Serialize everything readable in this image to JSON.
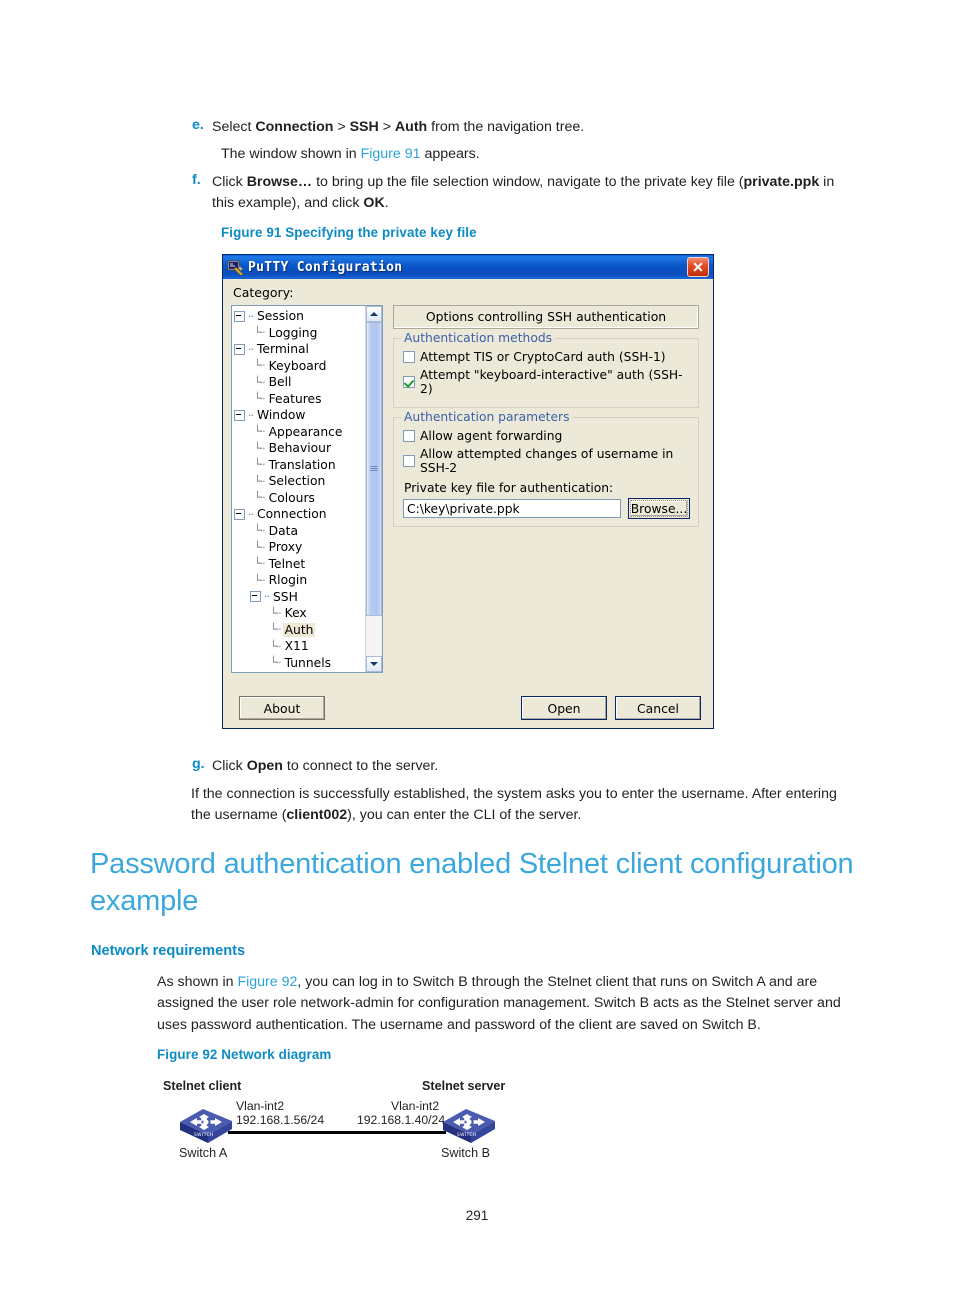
{
  "steps": [
    {
      "marker": "e.",
      "segments": [
        {
          "t": "Select ",
          "s": "normal"
        },
        {
          "t": "Connection",
          "s": "bold"
        },
        {
          "t": " > ",
          "s": "normal"
        },
        {
          "t": "SSH",
          "s": "bold"
        },
        {
          "t": " > ",
          "s": "normal"
        },
        {
          "t": "Auth",
          "s": "bold"
        },
        {
          "t": " from the navigation tree.",
          "s": "normal"
        }
      ]
    },
    {
      "marker": "f.",
      "segments": [
        {
          "t": "Click ",
          "s": "normal"
        },
        {
          "t": "Browse…",
          "s": "bold"
        },
        {
          "t": " to bring up the file selection window, navigate to the private key file (",
          "s": "normal"
        },
        {
          "t": "private.ppk",
          "s": "bold"
        },
        {
          "t": " in this example), and click ",
          "s": "normal"
        },
        {
          "t": "OK",
          "s": "bold"
        },
        {
          "t": ".",
          "s": "normal"
        }
      ]
    },
    {
      "marker": "g.",
      "segments": [
        {
          "t": "Click ",
          "s": "normal"
        },
        {
          "t": "Open",
          "s": "bold"
        },
        {
          "t": " to connect to the server.",
          "s": "normal"
        }
      ]
    }
  ],
  "paragraphs": {
    "window_shown": {
      "pre": "The window shown in ",
      "link": "Figure 91",
      "post": " appears."
    },
    "after_open": "If the connection is successfully established, the system asks you to enter the username. After entering the username (client002), you can enter the CLI of the server.",
    "after_open_parts": {
      "a": "If the connection is successfully established, the system asks you to enter the username. After entering the username (",
      "b": "client002",
      "c": "), you can enter the CLI of the server."
    },
    "network_req": {
      "a": "As shown in ",
      "link": "Figure 92",
      "b": ", you can log in to Switch B through the Stelnet client that runs on Switch A and are assigned the user role network-admin for configuration management. Switch B acts as the Stelnet server and uses password authentication. The username and password of the client are saved on Switch B."
    }
  },
  "figures": {
    "fig91_caption": "Figure 91 Specifying the private key file",
    "fig92_caption": "Figure 92 Network diagram"
  },
  "headings": {
    "section_title": "Password authentication enabled Stelnet client configuration example",
    "subsection_title": "Network requirements"
  },
  "page_number": "291",
  "colors": {
    "heading_blue": "#3aa8dd",
    "caption_blue": "#0c8bc4",
    "link_blue": "#2aa3d8",
    "titlebar_blue": "#0a55c8",
    "dialog_face": "#ece9d8",
    "switch_body": "#2b3a8c"
  },
  "putty": {
    "title": "PuTTY Configuration",
    "close_label": "✕",
    "category_label": "Category:",
    "tree": [
      {
        "label": "Session",
        "depth": 0,
        "expander": "minus",
        "selected": false
      },
      {
        "label": "Logging",
        "depth": 1,
        "expander": "none",
        "selected": false
      },
      {
        "label": "Terminal",
        "depth": 0,
        "expander": "minus",
        "selected": false
      },
      {
        "label": "Keyboard",
        "depth": 1,
        "expander": "none",
        "selected": false
      },
      {
        "label": "Bell",
        "depth": 1,
        "expander": "none",
        "selected": false
      },
      {
        "label": "Features",
        "depth": 1,
        "expander": "none",
        "selected": false
      },
      {
        "label": "Window",
        "depth": 0,
        "expander": "minus",
        "selected": false
      },
      {
        "label": "Appearance",
        "depth": 1,
        "expander": "none",
        "selected": false
      },
      {
        "label": "Behaviour",
        "depth": 1,
        "expander": "none",
        "selected": false
      },
      {
        "label": "Translation",
        "depth": 1,
        "expander": "none",
        "selected": false
      },
      {
        "label": "Selection",
        "depth": 1,
        "expander": "none",
        "selected": false
      },
      {
        "label": "Colours",
        "depth": 1,
        "expander": "none",
        "selected": false
      },
      {
        "label": "Connection",
        "depth": 0,
        "expander": "minus",
        "selected": false
      },
      {
        "label": "Data",
        "depth": 1,
        "expander": "none",
        "selected": false
      },
      {
        "label": "Proxy",
        "depth": 1,
        "expander": "none",
        "selected": false
      },
      {
        "label": "Telnet",
        "depth": 1,
        "expander": "none",
        "selected": false
      },
      {
        "label": "Rlogin",
        "depth": 1,
        "expander": "none",
        "selected": false
      },
      {
        "label": "SSH",
        "depth": 1,
        "expander": "minus",
        "selected": false
      },
      {
        "label": "Kex",
        "depth": 2,
        "expander": "none",
        "selected": false
      },
      {
        "label": "Auth",
        "depth": 2,
        "expander": "none",
        "selected": true
      },
      {
        "label": "X11",
        "depth": 2,
        "expander": "none",
        "selected": false
      },
      {
        "label": "Tunnels",
        "depth": 2,
        "expander": "none",
        "selected": false
      }
    ],
    "pane_title": "Options controlling SSH authentication",
    "group_methods": {
      "title": "Authentication methods",
      "items": [
        {
          "label": "Attempt TIS or CryptoCard auth (SSH-1)",
          "checked": false
        },
        {
          "label": "Attempt \"keyboard-interactive\" auth (SSH-2)",
          "checked": true
        }
      ]
    },
    "group_params": {
      "title": "Authentication parameters",
      "items": [
        {
          "label": "Allow agent forwarding",
          "checked": false
        },
        {
          "label": "Allow attempted changes of username in SSH-2",
          "checked": false
        }
      ],
      "key_file_label": "Private key file for authentication:",
      "key_file_value": "C:\\key\\private.ppk",
      "browse_label": "Browse..."
    },
    "buttons": {
      "about": "About",
      "open": "Open",
      "cancel": "Cancel"
    }
  },
  "network_diagram": {
    "left_role": "Stelnet client",
    "right_role": "Stelnet server",
    "left_iface": "Vlan-int2",
    "left_ip": "192.168.1.56/24",
    "right_iface": "Vlan-int2",
    "right_ip": "192.168.1.40/24",
    "left_device": "Switch A",
    "right_device": "Switch B"
  }
}
